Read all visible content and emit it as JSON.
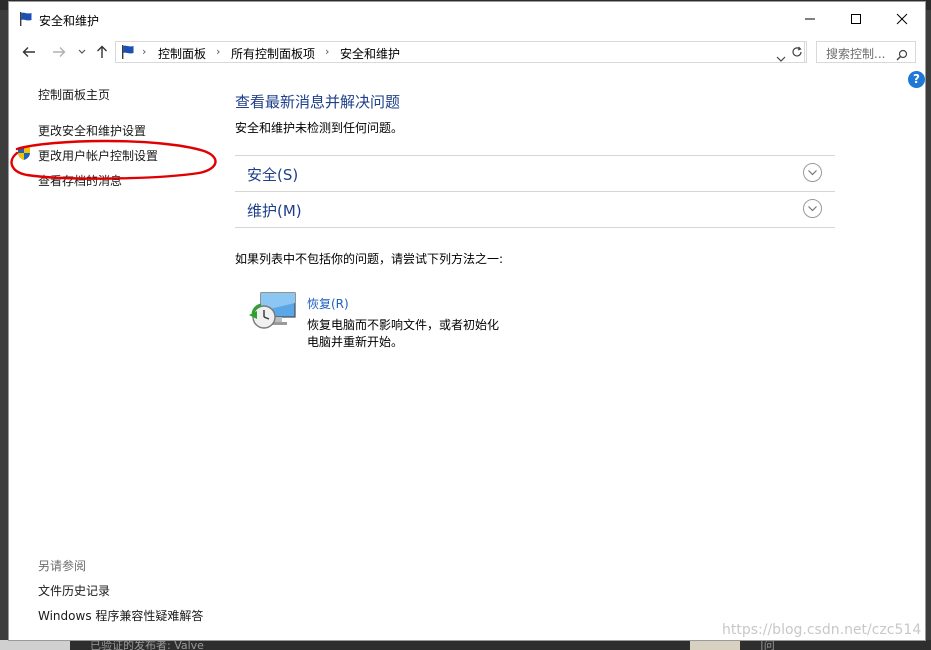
{
  "window": {
    "title": "安全和维护",
    "minimize_glyph": "—",
    "maximize_glyph": "☐",
    "close_glyph": "✕"
  },
  "background": {
    "bottom_text_left": "已验证的发布者: Valve",
    "bottom_text_right": "|问"
  },
  "address": {
    "crumbs": [
      "控制面板",
      "所有控制面板项",
      "安全和维护"
    ],
    "search_placeholder": "搜索控制..."
  },
  "sidebar": {
    "home": "控制面板主页",
    "items": [
      {
        "label": "更改安全和维护设置"
      },
      {
        "label": "更改用户帐户控制设置"
      },
      {
        "label": "查看存档的消息"
      }
    ],
    "see_also_heading": "另请参阅",
    "see_also": [
      {
        "label": "文件历史记录"
      },
      {
        "label": "Windows 程序兼容性疑难解答"
      }
    ]
  },
  "main": {
    "title": "查看最新消息并解决问题",
    "description": "安全和维护未检测到任何问题。",
    "sections": [
      {
        "label": "安全(S)"
      },
      {
        "label": "维护(M)"
      }
    ],
    "try_text": "如果列表中不包括你的问题，请尝试下列方法之一:",
    "recovery": {
      "link": "恢复(R)",
      "description": "恢复电脑而不影响文件，或者初始化电脑并重新开始。"
    }
  },
  "help_label": "?",
  "watermark": "https://blog.csdn.net/czc514",
  "colors": {
    "link_blue": "#1e3f8a",
    "help_blue": "#1e78d6",
    "annotation_red": "#e00000"
  }
}
